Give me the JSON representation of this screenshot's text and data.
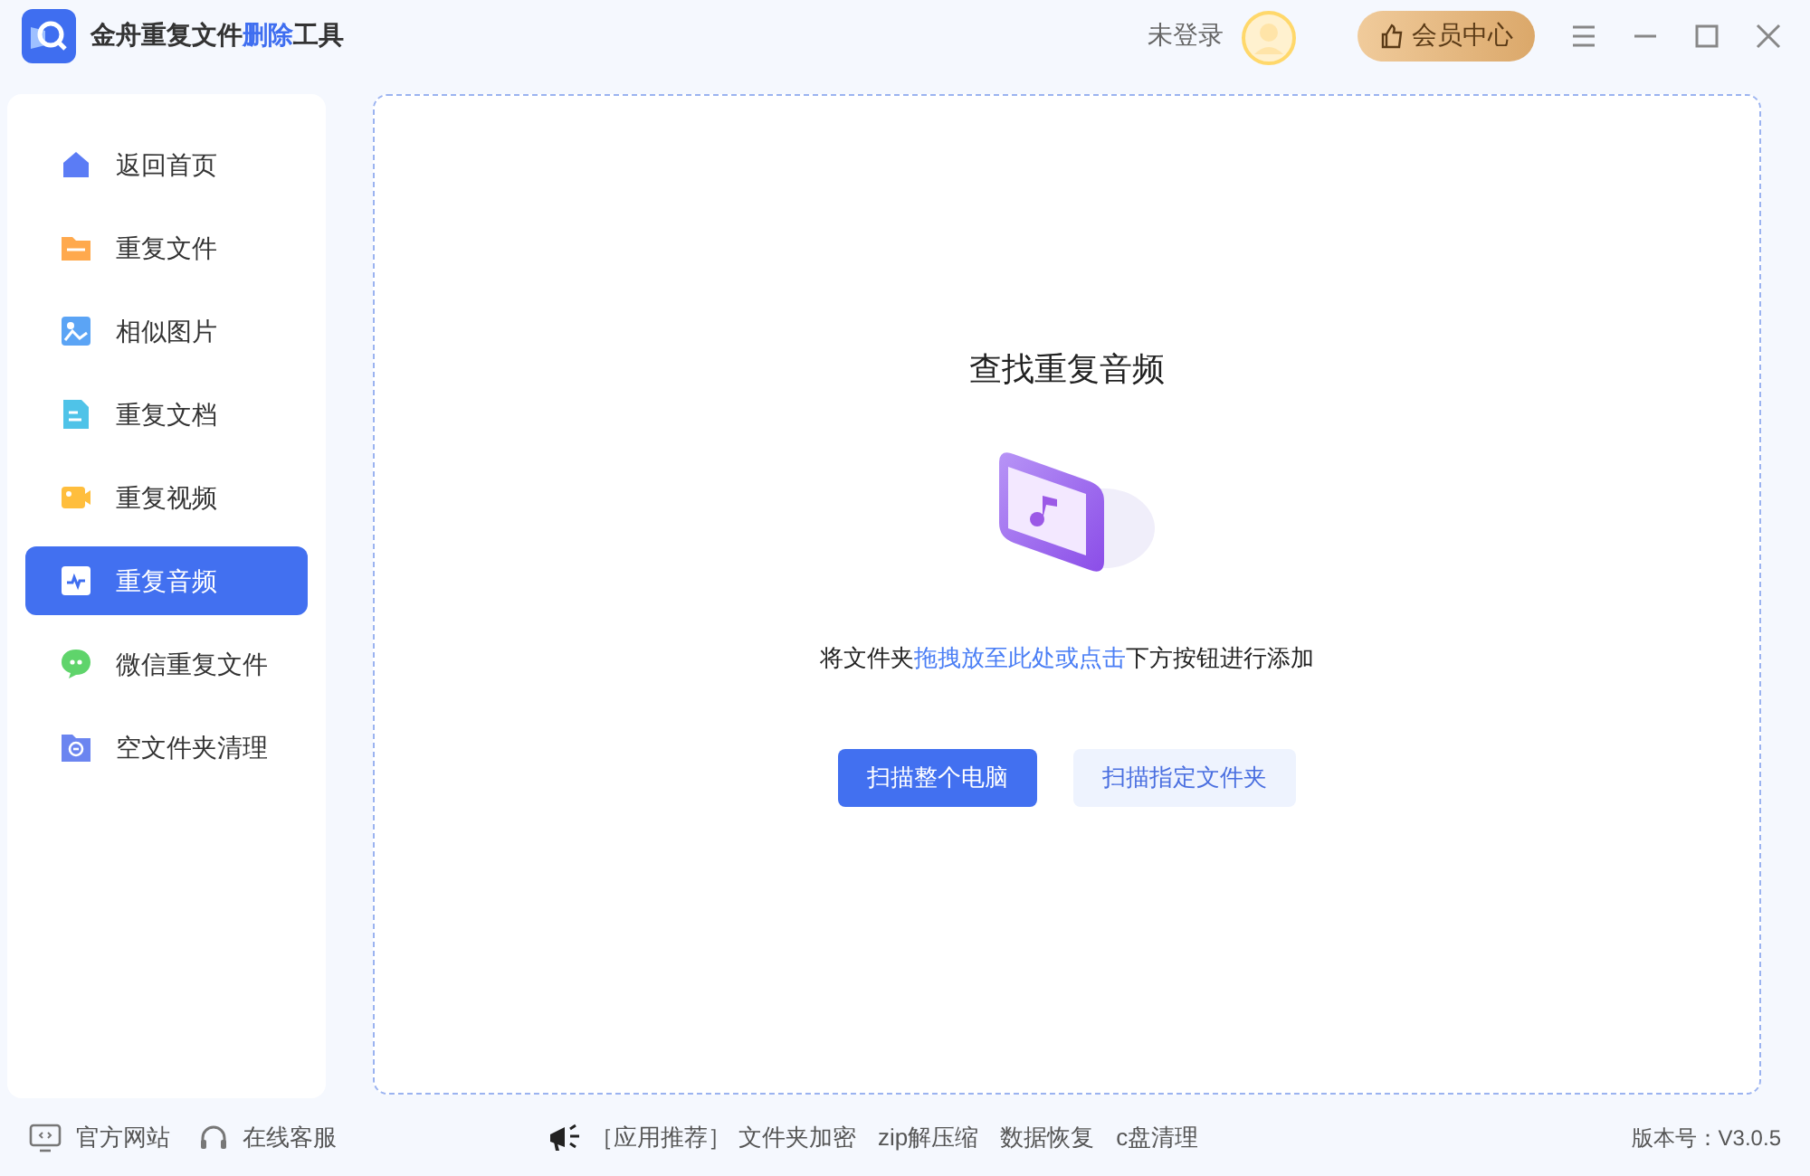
{
  "app": {
    "title": [
      {
        "text": "金舟重复文件",
        "highlight": false
      },
      {
        "text": "删除",
        "highlight": true
      },
      {
        "text": "工具",
        "highlight": false
      }
    ],
    "login": "未登录",
    "vip_button": "会员中心"
  },
  "sidebar": {
    "items": [
      {
        "kind": "home",
        "label": "返回首页",
        "selected": false
      },
      {
        "kind": "folder",
        "label": "重复文件",
        "selected": false
      },
      {
        "kind": "image",
        "label": "相似图片",
        "selected": false
      },
      {
        "kind": "document",
        "label": "重复文档",
        "selected": false
      },
      {
        "kind": "video",
        "label": "重复视频",
        "selected": false
      },
      {
        "kind": "audio",
        "label": "重复音频",
        "selected": true
      },
      {
        "kind": "chat",
        "label": "微信重复文件",
        "selected": false
      },
      {
        "kind": "empty-folder",
        "label": "空文件夹清理",
        "selected": false
      }
    ]
  },
  "main": {
    "heading": "查找重复音频",
    "hint": [
      {
        "text": "将文件夹",
        "highlight": false
      },
      {
        "text": "拖拽放至此处或点击",
        "highlight": true
      },
      {
        "text": "下方按钮进行添加",
        "highlight": false
      }
    ],
    "buttons": [
      {
        "kind": "primary",
        "label": "扫描整个电脑"
      },
      {
        "kind": "secondary",
        "label": "扫描指定文件夹"
      }
    ]
  },
  "footer": {
    "links": [
      {
        "kind": "monitor",
        "label": "官方网站"
      },
      {
        "kind": "headset",
        "label": "在线客服"
      }
    ],
    "promo_label": "［应用推荐］",
    "promos": [
      "文件夹加密",
      "zip解压缩",
      "数据恢复",
      "c盘清理"
    ],
    "version": "版本号：V3.0.5"
  }
}
